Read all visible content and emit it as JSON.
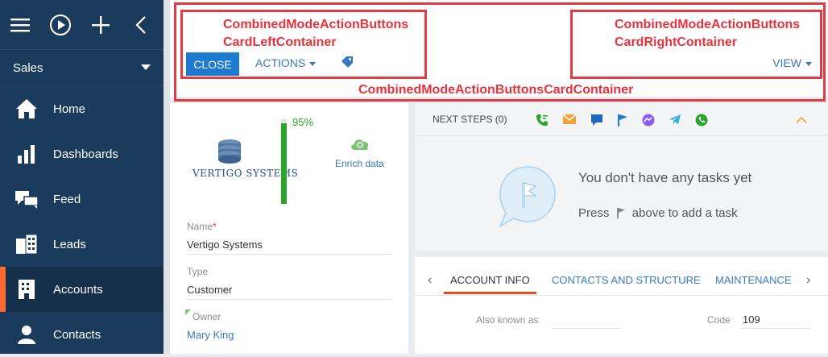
{
  "sidebar": {
    "section_label": "Sales",
    "items": [
      {
        "label": "Home",
        "icon": "home-icon",
        "active": false
      },
      {
        "label": "Dashboards",
        "icon": "bar-chart-icon",
        "active": false
      },
      {
        "label": "Feed",
        "icon": "chat-bubbles-icon",
        "active": false
      },
      {
        "label": "Leads",
        "icon": "leads-icon",
        "active": false
      },
      {
        "label": "Accounts",
        "icon": "building-icon",
        "active": true
      },
      {
        "label": "Contacts",
        "icon": "person-icon",
        "active": false
      }
    ]
  },
  "annotations": {
    "left_container": "CombinedModeActionButtons\nCardLeftContainer",
    "right_container": "CombinedModeActionButtons\nCardRightContainer",
    "container": "CombinedModeActionButtonsCardContainer"
  },
  "toolbar": {
    "close_label": "CLOSE",
    "actions_label": "ACTIONS",
    "view_label": "VIEW"
  },
  "profile": {
    "logo_text": "VERTIGO SYSTEMS",
    "completeness_pct": "95%",
    "completeness_value": 95,
    "enrich_label": "Enrich data",
    "fields": [
      {
        "label": "Name",
        "required": true,
        "value": "Vertigo Systems"
      },
      {
        "label": "Type",
        "required": false,
        "value": "Customer"
      },
      {
        "label": "Owner",
        "required": false,
        "value": "Mary King"
      }
    ]
  },
  "next_steps": {
    "title": "NEXT STEPS (0)",
    "empty_message": "You don't have any tasks yet",
    "hint_before": "Press",
    "hint_after": "above to add a task"
  },
  "tabs": {
    "items": [
      "ACCOUNT INFO",
      "CONTACTS AND STRUCTURE",
      "MAINTENANCE"
    ],
    "active": 0,
    "fields": [
      {
        "label": "Also known as",
        "value": ""
      },
      {
        "label": "Code",
        "value": "109"
      }
    ]
  },
  "colors": {
    "sidebar_bg": "#1b3b5c",
    "accent_orange": "#ff6a2f",
    "primary_blue": "#1e7ad1",
    "annotation_red": "#e03a45",
    "progress_green": "#2aa52a"
  }
}
